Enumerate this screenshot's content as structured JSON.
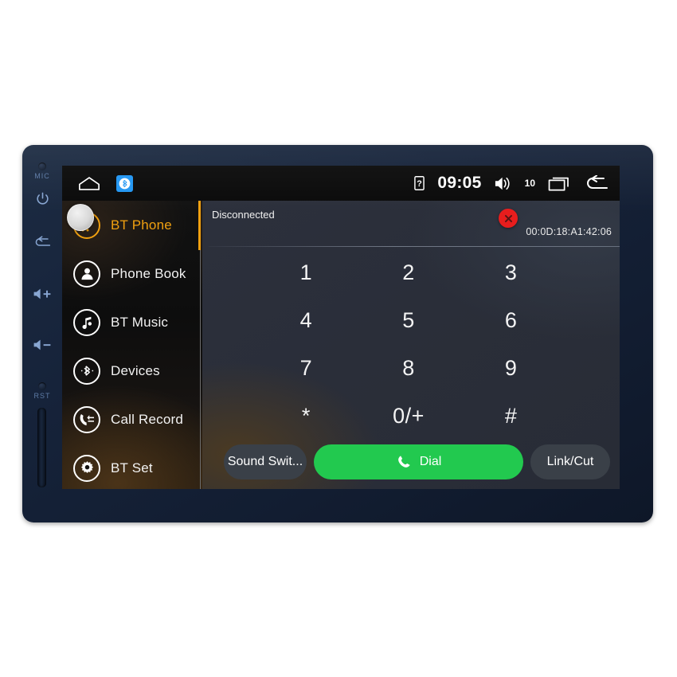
{
  "device": {
    "bezel": {
      "mic_label": "MIC",
      "rst_label": "RST",
      "power_icon": "power-icon",
      "back_icon": "back-arrow-icon",
      "volume_up_icon": "volume-up-icon",
      "volume_down_icon": "volume-down-icon",
      "sd_slot": "sd-card-slot"
    }
  },
  "statusbar": {
    "home_icon": "home-icon",
    "bluetooth_app_icon": "bluetooth-icon",
    "sim_icon": "sim-card-icon",
    "clock": "09:05",
    "volume_icon": "speaker-icon",
    "volume_level": "10",
    "recents_icon": "recents-icon",
    "back_icon": "back-arrow-icon"
  },
  "sidebar": {
    "items": [
      {
        "label": "BT Phone",
        "icon": "dialpad-icon",
        "active": true
      },
      {
        "label": "Phone Book",
        "icon": "contact-icon",
        "active": false
      },
      {
        "label": "BT Music",
        "icon": "music-note-icon",
        "active": false
      },
      {
        "label": "Devices",
        "icon": "bluetooth-icon",
        "active": false
      },
      {
        "label": "Call Record",
        "icon": "call-log-icon",
        "active": false
      },
      {
        "label": "BT Set",
        "icon": "gear-icon",
        "active": false
      }
    ]
  },
  "main": {
    "connection_status": "Disconnected",
    "disconnect_icon": "close-circle-icon",
    "mac_address": "00:0D:18:A1:42:06",
    "keypad": [
      "1",
      "2",
      "3",
      "4",
      "5",
      "6",
      "7",
      "8",
      "9",
      "*",
      "0/+",
      "#"
    ],
    "actions": {
      "sound_switch_label": "Sound Swit...",
      "dial_label": "Dial",
      "dial_icon": "phone-icon",
      "link_cut_label": "Link/Cut"
    }
  },
  "colors": {
    "accent_orange": "#f0a010",
    "dial_green": "#22c94f",
    "disconnect_red": "#e81d1d",
    "bt_blue": "#2196f3",
    "panel_bg": "#2a2e39"
  }
}
